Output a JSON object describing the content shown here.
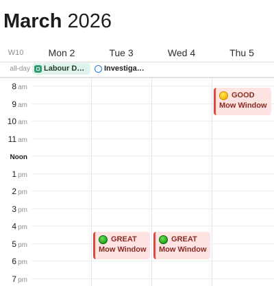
{
  "header": {
    "month": "March",
    "year": "2026"
  },
  "week_label": "W10",
  "days": [
    "Mon 2",
    "Tue 3",
    "Wed 4",
    "Thu 5"
  ],
  "allday": {
    "label": "all-day",
    "events": [
      {
        "title": "Labour D…",
        "icon": "calendar-icon",
        "color": "#2e9d6c"
      },
      {
        "title": "Investiga…",
        "icon": "circle-icon",
        "color": "#1a7ad9"
      }
    ]
  },
  "hours": [
    {
      "num": "8",
      "ap": "am"
    },
    {
      "num": "9",
      "ap": "am"
    },
    {
      "num": "10",
      "ap": "am"
    },
    {
      "num": "11",
      "ap": "am"
    },
    {
      "num": "Noon",
      "ap": ""
    },
    {
      "num": "1",
      "ap": "pm"
    },
    {
      "num": "2",
      "ap": "pm"
    },
    {
      "num": "3",
      "ap": "pm"
    },
    {
      "num": "4",
      "ap": "pm"
    },
    {
      "num": "5",
      "ap": "pm"
    },
    {
      "num": "6",
      "ap": "pm"
    },
    {
      "num": "7",
      "ap": "pm"
    }
  ],
  "events": [
    {
      "day": "Thu 5",
      "status": "GOOD",
      "status_icon": "yellow-circle-icon",
      "title": "Mow Window",
      "color": "#dc4a3f"
    },
    {
      "day": "Tue 3",
      "status": "GREAT",
      "status_icon": "green-circle-icon",
      "title": "Mow Window",
      "color": "#dc4a3f"
    },
    {
      "day": "Wed 4",
      "status": "GREAT",
      "status_icon": "green-circle-icon",
      "title": "Mow Window",
      "color": "#dc4a3f"
    }
  ]
}
